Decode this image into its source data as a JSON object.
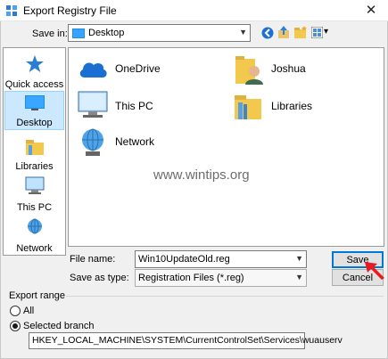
{
  "window": {
    "title": "Export Registry File",
    "close_glyph": "✕"
  },
  "toolbar": {
    "save_in_label": "Save in:",
    "location_value": "Desktop",
    "view_menu_arrow": "▾"
  },
  "places": [
    {
      "label": "Quick access",
      "icon": "star-icon"
    },
    {
      "label": "Desktop",
      "icon": "desktop-icon",
      "selected": true
    },
    {
      "label": "Libraries",
      "icon": "libraries-icon"
    },
    {
      "label": "This PC",
      "icon": "computer-icon"
    },
    {
      "label": "Network",
      "icon": "network-icon"
    }
  ],
  "items": [
    {
      "label": "OneDrive",
      "icon": "cloud-icon"
    },
    {
      "label": "Joshua",
      "icon": "user-folder-icon"
    },
    {
      "label": "This PC",
      "icon": "computer-icon"
    },
    {
      "label": "Libraries",
      "icon": "libraries-icon"
    },
    {
      "label": "Network",
      "icon": "network-icon"
    }
  ],
  "watermark": "www.wintips.org",
  "form": {
    "file_name_label": "File name:",
    "file_name_value": "Win10UpdateOld.reg",
    "save_as_label": "Save as type:",
    "save_as_value": "Registration Files (*.reg)",
    "save_button": "Save",
    "cancel_button": "Cancel"
  },
  "export_range": {
    "title": "Export range",
    "all_label": "All",
    "selected_label": "Selected branch",
    "branch_path": "HKEY_LOCAL_MACHINE\\SYSTEM\\CurrentControlSet\\Services\\wuauserv"
  },
  "colors": {
    "accent": "#0078d7",
    "selection": "#cce8ff",
    "arrow": "#e8191f"
  }
}
